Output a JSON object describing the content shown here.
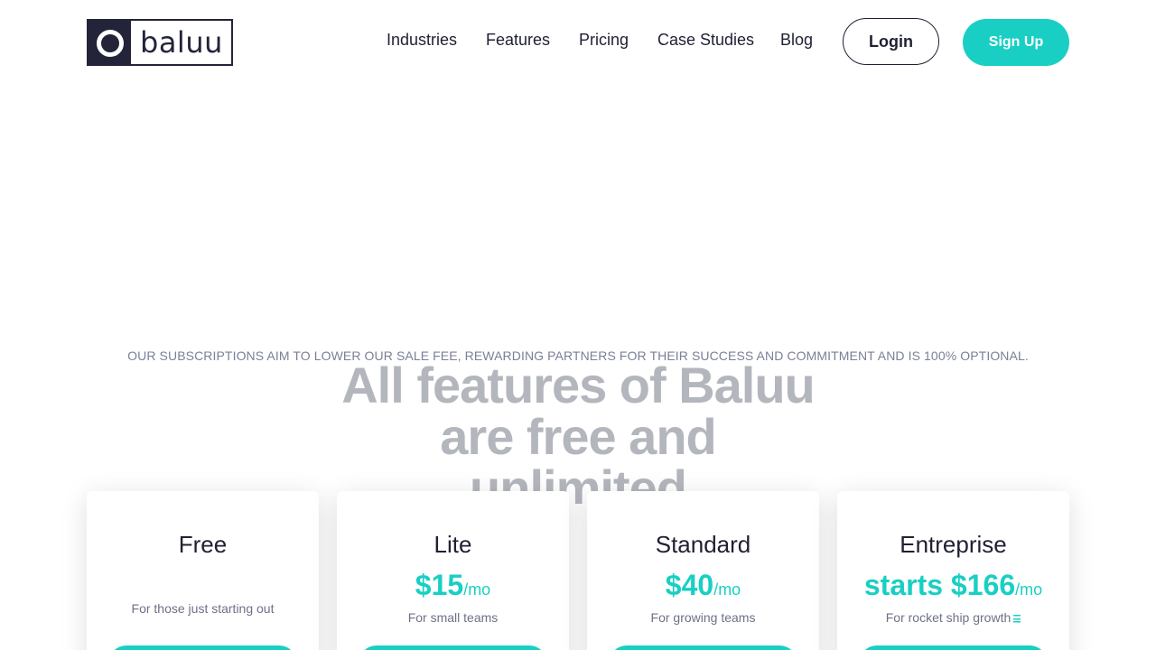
{
  "brand": {
    "name": "baluu"
  },
  "nav": {
    "items": [
      {
        "label": "Industries"
      },
      {
        "label": "Features"
      },
      {
        "label": "Pricing"
      },
      {
        "label": "Case Studies"
      },
      {
        "label": "Blog"
      }
    ],
    "login_label": "Login",
    "signup_label": "Sign Up"
  },
  "hero": {
    "eyebrow": "OUR SUBSCRIPTIONS AIM TO LOWER OUR SALE FEE, REWARDING PARTNERS FOR THEIR SUCCESS AND COMMITMENT AND IS 100% OPTIONAL.",
    "headline_line1": "All features of Baluu",
    "headline_line2": "are free and",
    "headline_line3": "unlimited"
  },
  "plans": [
    {
      "name": "Free",
      "price": "",
      "per": "",
      "description": "For those just starting out"
    },
    {
      "name": "Lite",
      "price": "$15",
      "per": "/mo",
      "description": "For small teams"
    },
    {
      "name": "Standard",
      "price": "$40",
      "per": "/mo",
      "description": "For growing teams"
    },
    {
      "name": "Entreprise",
      "price": "starts $166",
      "per": "/mo",
      "description": "For rocket ship growth"
    }
  ],
  "colors": {
    "accent": "#19cfc3",
    "text_dark": "#1f2033",
    "headline_muted": "#b4b6bd"
  }
}
